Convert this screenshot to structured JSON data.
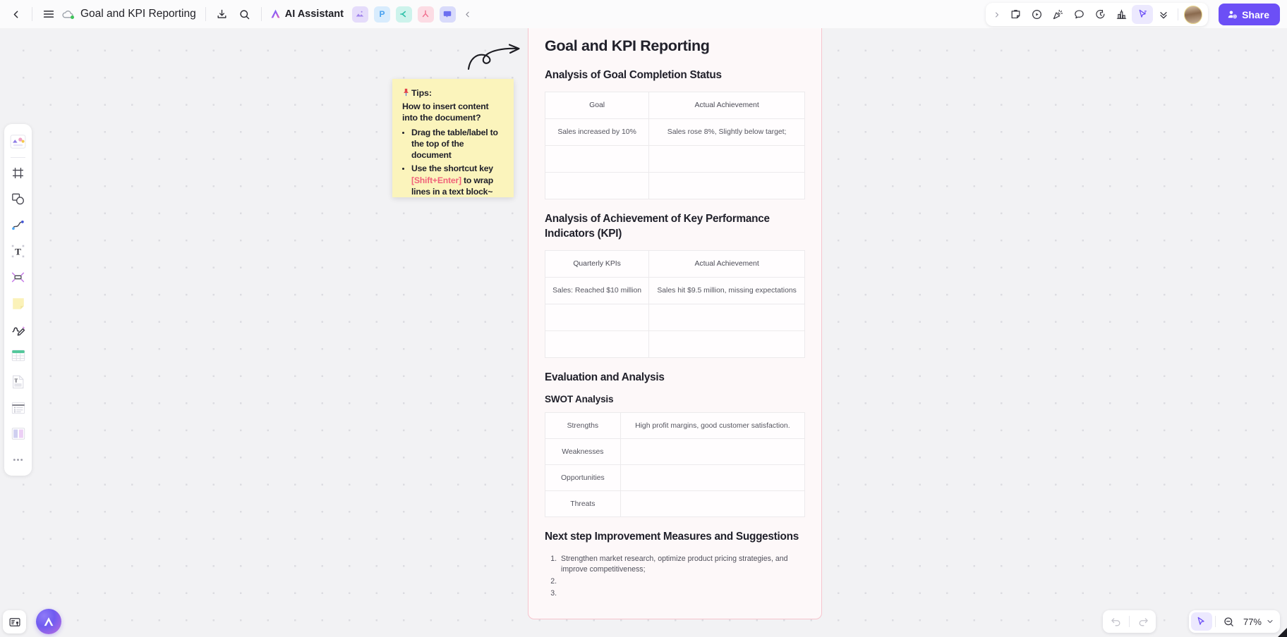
{
  "app": {
    "accent": "#6c4ff6",
    "canvas_bg": "#f2f2f4",
    "doc_border": "#f6c4cd",
    "doc_bg": "#fdf8f9",
    "sticky_bg": "#fbf4bc",
    "highlight_color": "#f0637a"
  },
  "topbar": {
    "back_icon": "chevron-left-icon",
    "menu_icon": "hamburger-menu-icon",
    "cloud_icon": "cloud-saved-icon",
    "doc_title": "Goal and KPI Reporting",
    "download_icon": "download-icon",
    "search_icon": "search-icon",
    "ai_assistant_label": "AI Assistant",
    "ai_assistant_icon": "ai-sparkle-icon",
    "apps": [
      {
        "name": "image-app-icon",
        "glyph": "◢",
        "bg": "#e5dcfb",
        "fg": "#9b7ae8"
      },
      {
        "name": "presentation-app-icon",
        "glyph": "P",
        "bg": "#d8ecfd",
        "fg": "#4aa2f0"
      },
      {
        "name": "mindmap-app-icon",
        "glyph": "⊂",
        "bg": "#cdf3ec",
        "fg": "#2bbfa7"
      },
      {
        "name": "flowchart-app-icon",
        "glyph": "⑂",
        "bg": "#fcdce4",
        "fg": "#f0708f"
      },
      {
        "name": "chat-app-icon",
        "glyph": "▭",
        "bg": "#d9dbfb",
        "fg": "#6c6ff0"
      }
    ],
    "collapse_icon": "chevron-left-icon"
  },
  "right_toolbar": {
    "expand_icon": "chevron-right-icon",
    "buttons": [
      {
        "name": "sticky-note-tool",
        "icon": "sticky-note-icon"
      },
      {
        "name": "media-play-tool",
        "icon": "play-circle-icon"
      },
      {
        "name": "celebrate-tool",
        "icon": "party-popper-icon"
      },
      {
        "name": "comment-tool",
        "icon": "comment-bubble-icon"
      },
      {
        "name": "timer-tool",
        "icon": "timer-icon"
      },
      {
        "name": "vote-tool",
        "icon": "vote-chart-icon"
      },
      {
        "name": "select-tool",
        "icon": "cursor-arrow-icon",
        "active": true
      },
      {
        "name": "more-tools",
        "icon": "chevrons-down-icon"
      }
    ],
    "avatar_name": "user-avatar",
    "share_label": "Share",
    "share_icon": "share-person-icon"
  },
  "left_rail": {
    "items": [
      {
        "name": "rail-item-assets",
        "icon": "shapes-gallery-icon"
      },
      {
        "name": "rail-item-frame",
        "icon": "frame-icon"
      },
      {
        "name": "rail-item-shape",
        "icon": "shapes-icon"
      },
      {
        "name": "rail-item-connector",
        "icon": "curve-line-icon"
      },
      {
        "name": "rail-item-text",
        "icon": "text-tool-icon"
      },
      {
        "name": "rail-item-arrange",
        "icon": "group-resize-icon"
      },
      {
        "name": "rail-item-sticky",
        "icon": "sticky-note-icon"
      },
      {
        "name": "rail-item-draw",
        "icon": "pen-draw-icon"
      },
      {
        "name": "rail-item-table",
        "icon": "table-icon"
      },
      {
        "name": "rail-item-document",
        "icon": "document-icon"
      },
      {
        "name": "rail-item-list",
        "icon": "list-block-icon"
      },
      {
        "name": "rail-item-columns",
        "icon": "columns-layout-icon"
      },
      {
        "name": "rail-item-more",
        "icon": "ellipsis-icon"
      }
    ]
  },
  "sticky_note": {
    "pin_icon": "pushpin-icon",
    "title": "Tips:",
    "question": "How to insert content into the document?",
    "bullets": [
      {
        "pre": "Drag the table/label to the top of the document",
        "key": "",
        "post": ""
      },
      {
        "pre": "Use the shortcut key ",
        "key": "[Shift+Enter]",
        "post": " to wrap lines in a text block~"
      }
    ]
  },
  "doodle": {
    "name": "hand-drawn-loop-arrow"
  },
  "document": {
    "title": "Goal and KPI Reporting",
    "sections": [
      {
        "heading": "Analysis of Goal Completion Status",
        "table": {
          "headers": [
            "Goal",
            "Actual Achievement"
          ],
          "rows": [
            [
              "Sales increased by 10%",
              "Sales rose 8%, Slightly below target;"
            ],
            [
              "",
              ""
            ],
            [
              "",
              ""
            ]
          ]
        }
      },
      {
        "heading": "Analysis of Achievement of Key Performance Indicators (KPI)",
        "table": {
          "headers": [
            "Quarterly KPIs",
            "Actual Achievement"
          ],
          "rows": [
            [
              "Sales: Reached $10 million",
              "Sales hit $9.5 million, missing expectations"
            ],
            [
              "",
              ""
            ],
            [
              "",
              ""
            ]
          ]
        }
      }
    ],
    "evaluation": {
      "heading": "Evaluation and Analysis",
      "subheading": "SWOT Analysis",
      "rows": [
        [
          "Strengths",
          "High profit margins, good customer satisfaction."
        ],
        [
          "Weaknesses",
          ""
        ],
        [
          "Opportunities",
          ""
        ],
        [
          "Threats",
          ""
        ]
      ]
    },
    "next_steps": {
      "heading": "Next step Improvement Measures and Suggestions",
      "items": [
        "Strengthen market research, optimize product pricing strategies, and improve competitiveness;",
        "",
        ""
      ]
    }
  },
  "bottom_left": {
    "minimap_icon": "minimap-location-icon",
    "ai_button_icon": "ai-assistant-orb-icon"
  },
  "bottom_right": {
    "undo_icon": "undo-arrow-icon",
    "redo_icon": "redo-arrow-icon",
    "pointer_icon": "cursor-arrow-icon",
    "zoom_out_icon": "zoom-out-icon",
    "zoom_level": "77%",
    "zoom_chevron_icon": "chevron-down-icon"
  }
}
